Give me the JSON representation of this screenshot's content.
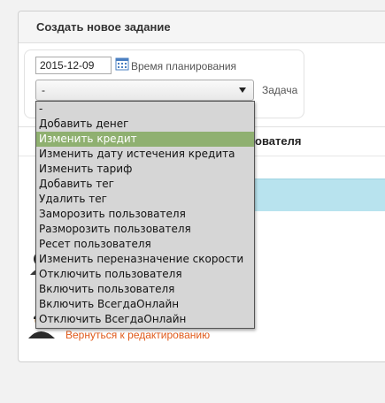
{
  "panel": {
    "title": "Создать новое задание"
  },
  "form": {
    "date_value": "2015-12-09",
    "plan_label": "Время планирования",
    "task_select_value": "-",
    "task_label": "Задача"
  },
  "table": {
    "column_header_fragment": "ователя"
  },
  "footer": {
    "back_link": "Вернуться к редактированию"
  },
  "dropdown": {
    "options": [
      "-",
      "Добавить денег",
      "Изменить кредит",
      "Изменить дату истечения кредита",
      "Изменить тариф",
      "Добавить тег",
      "Удалить тег",
      "Заморозить пользователя",
      "Разморозить пользователя",
      "Ресет пользователя",
      "Изменить переназначение скорости",
      "Отключить пользователя",
      "Включить пользователя",
      "Включить ВсегдаОнлайн",
      "Отключить ВсегдаОнлайн"
    ],
    "highlighted": "Изменить кредит"
  },
  "colors": {
    "highlight": "#8fb070",
    "info_bar": "#b8e3ee",
    "link": "#e05a1a"
  }
}
